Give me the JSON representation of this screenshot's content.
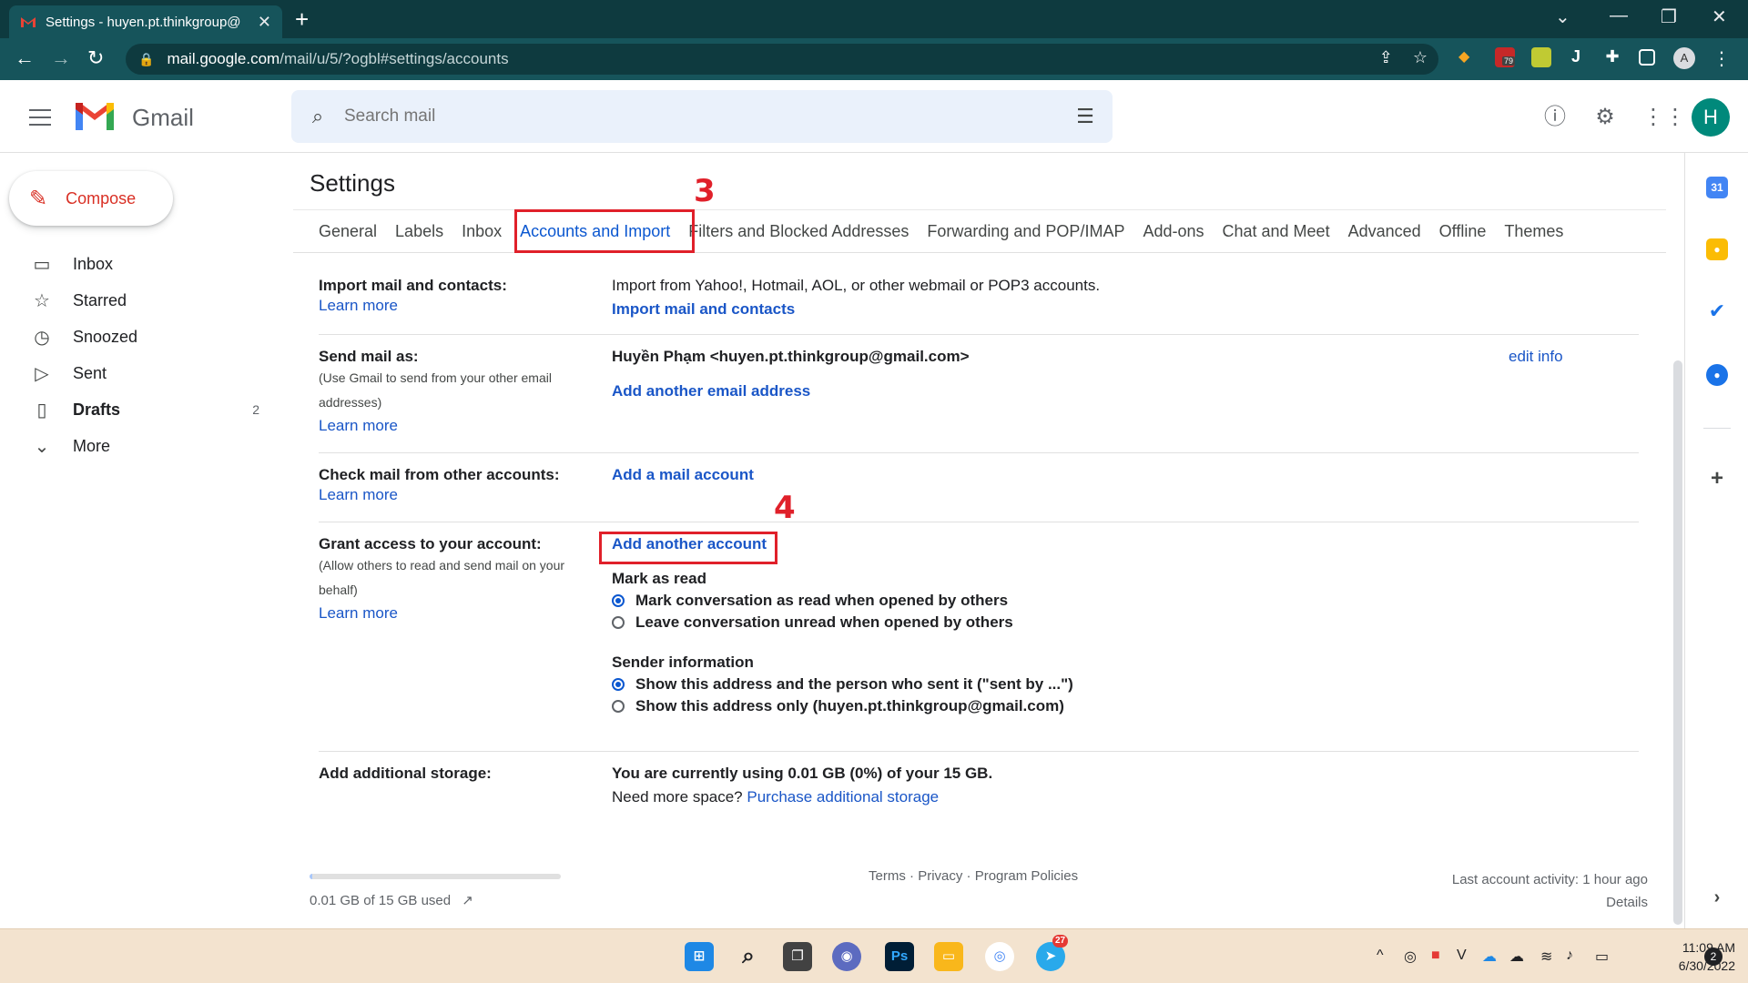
{
  "browser": {
    "tab_title": "Settings - huyen.pt.thinkgroup@",
    "url_host": "mail.google.com",
    "url_path": "/mail/u/5/?ogbl#settings/accounts",
    "new_tab_label": "+",
    "close_tab_label": "✕"
  },
  "gmail": {
    "product_name": "Gmail",
    "search_placeholder": "Search mail",
    "avatar_letter": "H",
    "brand_colors": {
      "red": "#ea4335",
      "blue": "#4285f4",
      "green": "#34a853",
      "yellow": "#fbbc04"
    }
  },
  "nav": {
    "compose": "Compose",
    "items": [
      {
        "label": "Inbox",
        "icon": "inbox-icon",
        "glyph": "▭",
        "count": ""
      },
      {
        "label": "Starred",
        "icon": "star-icon",
        "glyph": "☆",
        "count": ""
      },
      {
        "label": "Snoozed",
        "icon": "clock-icon",
        "glyph": "◷",
        "count": ""
      },
      {
        "label": "Sent",
        "icon": "send-icon",
        "glyph": "▷",
        "count": ""
      },
      {
        "label": "Drafts",
        "icon": "file-icon",
        "glyph": "▯",
        "count": "2"
      },
      {
        "label": "More",
        "icon": "chevron-down-icon",
        "glyph": "⌄",
        "count": ""
      }
    ]
  },
  "settings": {
    "title": "Settings",
    "tabs": [
      "General",
      "Labels",
      "Inbox",
      "Accounts and Import",
      "Filters and Blocked Addresses",
      "Forwarding and POP/IMAP",
      "Add-ons",
      "Chat and Meet",
      "Advanced",
      "Offline",
      "Themes"
    ],
    "active_tab": "Accounts and Import",
    "annotations": {
      "step3": "3",
      "step4": "4"
    },
    "import": {
      "label": "Import mail and contacts:",
      "learn": "Learn more",
      "desc": "Import from Yahoo!, Hotmail, AOL, or other webmail or POP3 accounts.",
      "action": "Import mail and contacts"
    },
    "sendas": {
      "label": "Send mail as:",
      "sub": "(Use Gmail to send from your other email addresses)",
      "learn": "Learn more",
      "identity": "Huyền Phạm <huyen.pt.thinkgroup@gmail.com>",
      "edit": "edit info",
      "add": "Add another email address"
    },
    "checkmail": {
      "label": "Check mail from other accounts:",
      "learn": "Learn more",
      "add": "Add a mail account"
    },
    "grant": {
      "label": "Grant access to your account:",
      "sub": "(Allow others to read and send mail on your behalf)",
      "learn": "Learn more",
      "add": "Add another account",
      "markread_title": "Mark as read",
      "markread_opt1": "Mark conversation as read when opened by others",
      "markread_opt2": "Leave conversation unread when opened by others",
      "sender_title": "Sender information",
      "sender_opt1": "Show this address and the person who sent it (\"sent by ...\")",
      "sender_opt2": "Show this address only (huyen.pt.thinkgroup@gmail.com)"
    },
    "storage": {
      "label": "Add additional storage:",
      "usage": "You are currently using 0.01 GB (0%) of your 15 GB.",
      "need": "Need more space?",
      "purchase": "Purchase additional storage"
    }
  },
  "footer": {
    "storage_used": "0.01 GB of 15 GB used",
    "storage_fraction": 0.0007,
    "terms": "Terms",
    "sep1": " · ",
    "privacy": "Privacy",
    "sep2": " · ",
    "policies": "Program Policies",
    "activity": "Last account activity: 1 hour ago",
    "details": "Details"
  },
  "taskbar": {
    "time": "11:09 AM",
    "date": "6/30/2022",
    "notif_count": "2",
    "telegram_badge": "27",
    "ublock_badge": "79"
  }
}
